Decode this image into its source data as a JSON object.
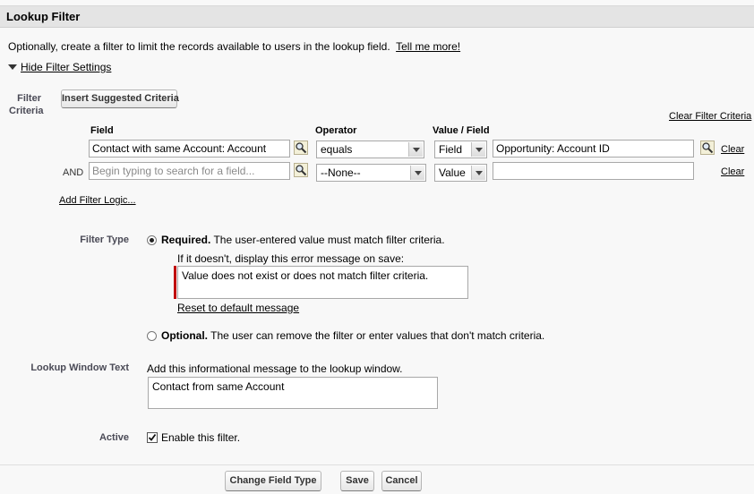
{
  "section": {
    "title": "Lookup Filter"
  },
  "intro": {
    "text": "Optionally, create a filter to limit the records available to users in the lookup field.",
    "tell_me_more": "Tell me more!"
  },
  "hide_filter_settings": "Hide Filter Settings",
  "filter_criteria": {
    "label_line1": "Filter",
    "label_line2": "Criteria",
    "insert_suggested": "Insert Suggested Criteria",
    "clear_filter_criteria": "Clear Filter Criteria",
    "headers": {
      "field": "Field",
      "operator": "Operator",
      "value_field": "Value / Field"
    },
    "rows": [
      {
        "connector": "",
        "field": "Contact with same Account: Account",
        "operator": "equals",
        "type": "Field",
        "value": "Opportunity: Account ID",
        "clear": "Clear"
      },
      {
        "connector": "AND",
        "field_placeholder": "Begin typing to search for a field...",
        "operator": "--None--",
        "type": "Value",
        "value": "",
        "clear": "Clear"
      }
    ],
    "add_filter_logic": "Add Filter Logic..."
  },
  "filter_type": {
    "label": "Filter Type",
    "required_bold": "Required.",
    "required_text": "The user-entered value must match filter criteria.",
    "error_prompt": "If it doesn't, display this error message on save:",
    "error_message": "Value does not exist or does not match filter criteria.",
    "reset_link": "Reset to default message",
    "optional_bold": "Optional.",
    "optional_text": "The user can remove the filter or enter values that don't match criteria.",
    "selected": "required"
  },
  "lookup_window": {
    "label": "Lookup Window Text",
    "hint": "Add this informational message to the lookup window.",
    "value": "Contact from same Account"
  },
  "active": {
    "label": "Active",
    "checkbox_label": "Enable this filter.",
    "checked": true
  },
  "buttons": {
    "change_field_type": "Change Field Type",
    "save": "Save",
    "cancel": "Cancel"
  },
  "colors": {
    "error_bar": "#c00000",
    "header_bg": "#e4e4e4"
  }
}
